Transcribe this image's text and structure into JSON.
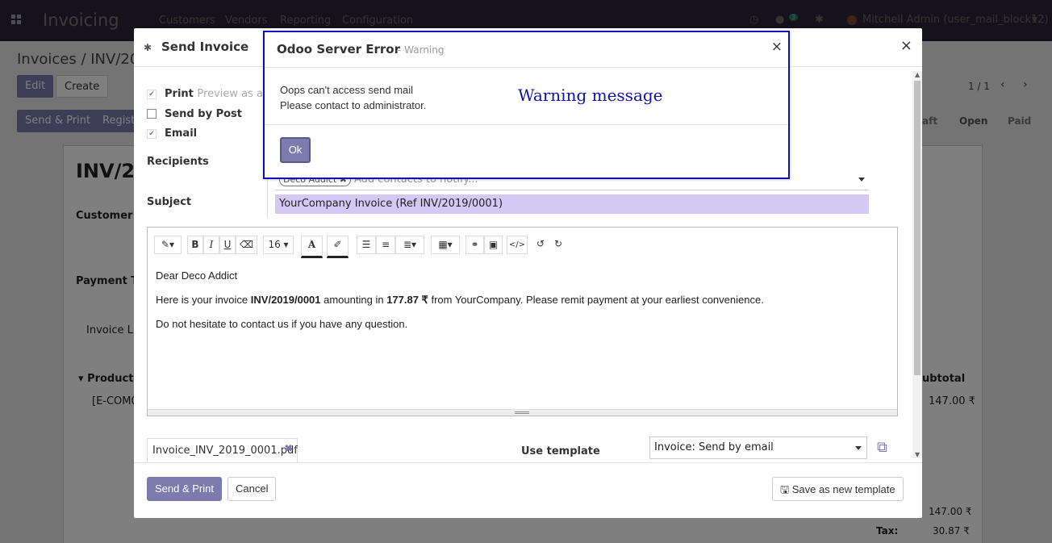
{
  "topbar": {
    "app_name": "Invoicing",
    "menu": [
      "Customers",
      "Vendors",
      "Reporting",
      "Configuration"
    ],
    "message_count": "3",
    "user": "Mitchell Admin (user_mail_block12)"
  },
  "background": {
    "breadcrumb": "Invoices / INV/201",
    "edit": "Edit",
    "create": "Create",
    "send_print": "Send & Print",
    "register": "Registe",
    "pager": "1 / 1",
    "status_draft": "aft",
    "status_open": "Open",
    "status_paid": "Paid",
    "inv_title": "INV/20",
    "customer": "Customer",
    "payment_terms": "Payment Te",
    "invoice_lines_tab": "Invoice Lin",
    "product_col": "Product",
    "subtotal_col": "ubtotal",
    "line_product": "[E-COM0",
    "line_amount": "147.00 ₹",
    "total_amount": "147.00 ₹",
    "tax_label": "Tax:",
    "tax_amount": "30.87 ₹"
  },
  "modal": {
    "title": "Send Invoice",
    "print_label": "Print",
    "print_hint": "Preview as a PD",
    "post_label": "Send by Post",
    "email_label": "Email",
    "recipients_label": "Recipients",
    "recipient_tag": "Deco Addict",
    "recipients_placeholder": "Add contacts to notify...",
    "subject_label": "Subject",
    "subject_value": "YourCompany Invoice (Ref INV/2019/0001)",
    "font_size": "16",
    "body": {
      "greeting": "Dear Deco Addict",
      "line_pre": "Here is your invoice ",
      "invoice_ref": "INV/2019/0001",
      "line_mid": " amounting in ",
      "amount": "177.87 ₹",
      "line_post": " from YourCompany. Please remit payment at your earliest convenience.",
      "closing": "Do not hesitate to contact us if you have any question."
    },
    "attachment": "Invoice_INV_2019_0001.pdf",
    "use_template_label": "Use template",
    "template_value": "Invoice: Send by email",
    "send_print_button": "Send & Print",
    "cancel_button": "Cancel",
    "save_template_button": "Save as new template"
  },
  "error_dialog": {
    "title": "Odoo Server Error",
    "subtitle": "- Warning",
    "line1": "Oops can't access send mail",
    "line2": "Please contact to administrator.",
    "annotation": "Warning  message",
    "ok_button": "Ok"
  },
  "colors": {
    "primary": "#7c7bad",
    "annotation_blue": "#1010b8",
    "subject_bg": "#d4c8f4"
  }
}
